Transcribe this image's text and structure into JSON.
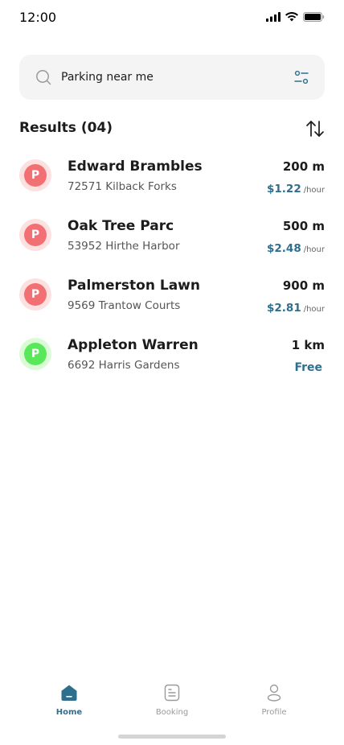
{
  "status_bar": {
    "time": "12:00",
    "icons": [
      "signal-icon",
      "wifi-icon",
      "battery-icon"
    ]
  },
  "search": {
    "value": "Parking near me",
    "icon": "search-icon",
    "filter_icon": "filter-icon"
  },
  "results": {
    "title": "Results (04)",
    "sort_icon": "sort-icon",
    "items": [
      {
        "name": "Edward Brambles",
        "address": "72571 Kilback Forks",
        "distance": "200 m",
        "price": "$1.22",
        "unit": "/hour",
        "status": "occupied"
      },
      {
        "name": "Oak Tree Parc",
        "address": "53952 Hirthe Harbor",
        "distance": "500 m",
        "price": "$2.48",
        "unit": "/hour",
        "status": "occupied"
      },
      {
        "name": "Palmerston Lawn",
        "address": "9569 Trantow Courts",
        "distance": "900 m",
        "price": "$2.81",
        "unit": "/hour",
        "status": "occupied"
      },
      {
        "name": "Appleton Warren",
        "address": "6692 Harris Gardens",
        "distance": "1 km",
        "price": "Free",
        "unit": "",
        "status": "available"
      }
    ],
    "pin_letter": "P"
  },
  "nav": {
    "items": [
      {
        "label": "Home",
        "icon": "home-icon",
        "active": true
      },
      {
        "label": "Booking",
        "icon": "booking-icon",
        "active": false
      },
      {
        "label": "Profile",
        "icon": "profile-icon",
        "active": false
      }
    ]
  },
  "colors": {
    "accent": "#2e6f8e",
    "pin_red_outer": "#fde0e0",
    "pin_red_inner": "#f26f73",
    "pin_green_outer": "#dafbd6",
    "pin_green_inner": "#58e85a",
    "search_bg": "#f4f4f4"
  }
}
